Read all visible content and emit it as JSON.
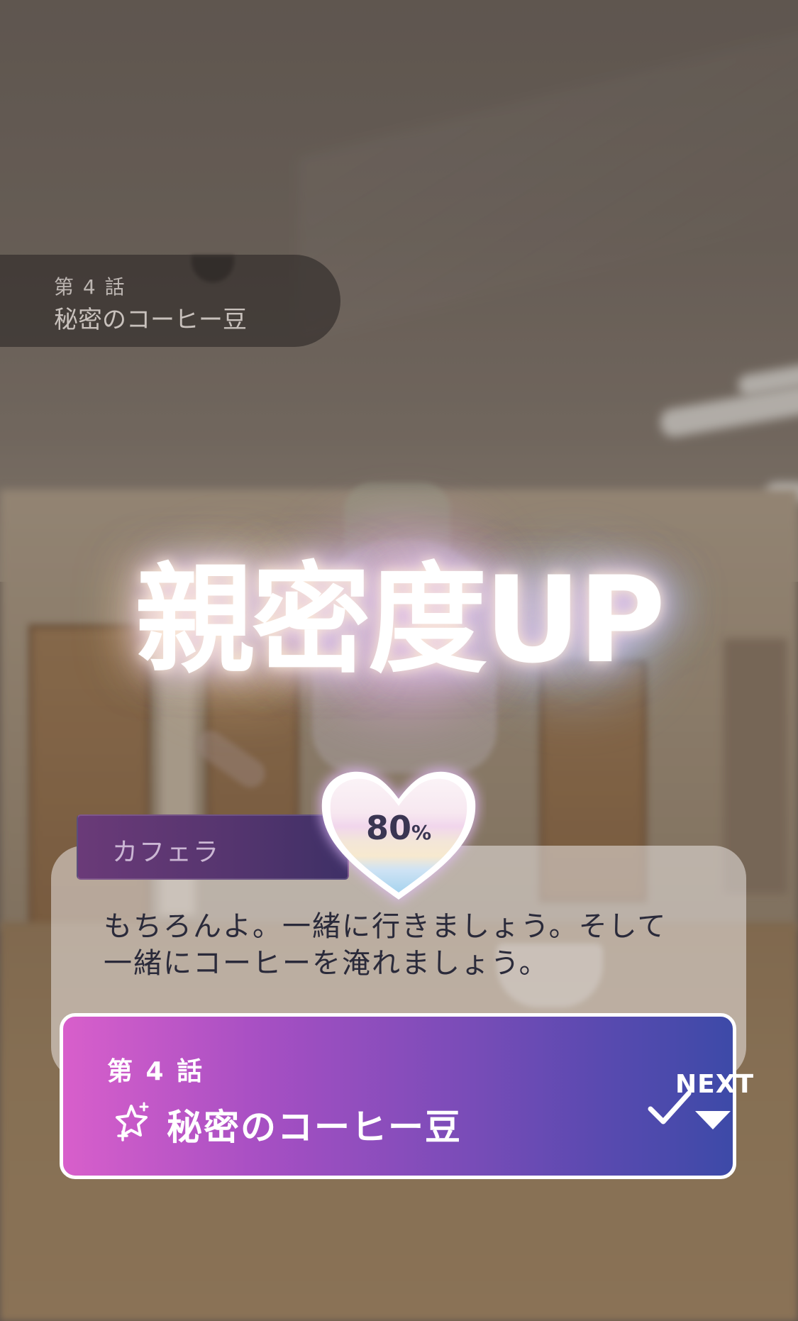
{
  "episode_header": {
    "number": "第 4 話",
    "title": "秘密のコーヒー豆"
  },
  "intimacy": {
    "title": "親密度UP",
    "percent_value": "80",
    "percent_unit": "%",
    "level": 0.8
  },
  "dialogue": {
    "speaker": "カフェラ",
    "text_line1": "もちろんよ。一緒に行きましょう。そして",
    "text_line2": "一緒にコーヒーを淹れましょう。"
  },
  "episode_card": {
    "number": "第 4 話",
    "title": "秘密のコーヒー豆",
    "icon": "sparkle-star-icon",
    "status_icon": "check-icon"
  },
  "next_control": {
    "label": "NEXT",
    "icon": "triangle-down-icon"
  },
  "colors": {
    "card_gradient_start": "#d85fcb",
    "card_gradient_end": "#3d4aa8",
    "name_tag": "#56356f"
  }
}
